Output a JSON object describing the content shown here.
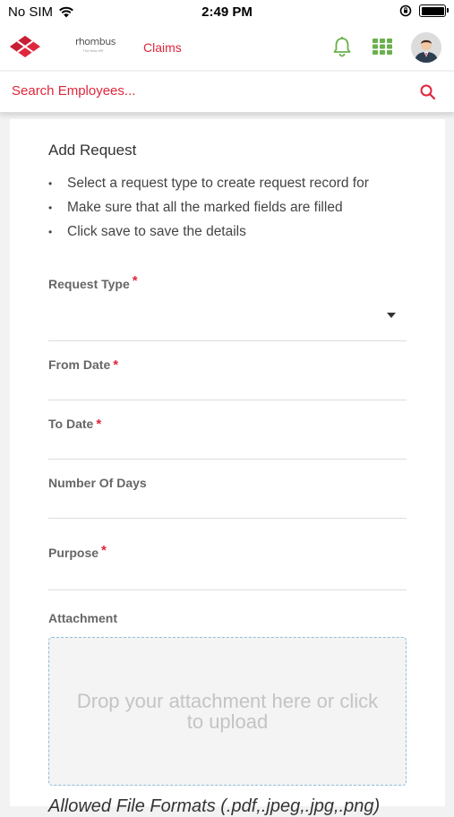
{
  "status_bar": {
    "carrier": "No SIM",
    "time": "2:49 PM",
    "icons": [
      "wifi-icon",
      "orientation-lock-icon",
      "battery-icon"
    ]
  },
  "header": {
    "logo": "diamond-logo-icon",
    "brand_name": "rhombus",
    "brand_tagline": "The New HR",
    "module_label": "Claims",
    "icons": [
      "bell-icon",
      "apps-grid-icon",
      "avatar"
    ],
    "colors": {
      "accent": "#e0263c",
      "icon_green": "#6ab04c"
    }
  },
  "search": {
    "placeholder": "Search Employees..."
  },
  "form": {
    "title": "Add Request",
    "instructions": [
      "Select a request type to create request record for",
      "Make sure that all the marked fields are filled",
      "Click save to save the details"
    ],
    "fields": {
      "request_type": {
        "label": "Request Type",
        "required": "*",
        "value": ""
      },
      "from_date": {
        "label": "From Date",
        "required": "*",
        "value": ""
      },
      "to_date": {
        "label": "To Date",
        "required": "*",
        "value": ""
      },
      "number_of_days": {
        "label": "Number Of Days",
        "value": ""
      },
      "purpose": {
        "label": "Purpose",
        "required": "*",
        "value": ""
      }
    },
    "attachment": {
      "label": "Attachment",
      "dropzone_text": "Drop your attachment here or click to upload",
      "formats_note": "Allowed File Formats (.pdf,.jpeg,.jpg,.png)"
    }
  }
}
